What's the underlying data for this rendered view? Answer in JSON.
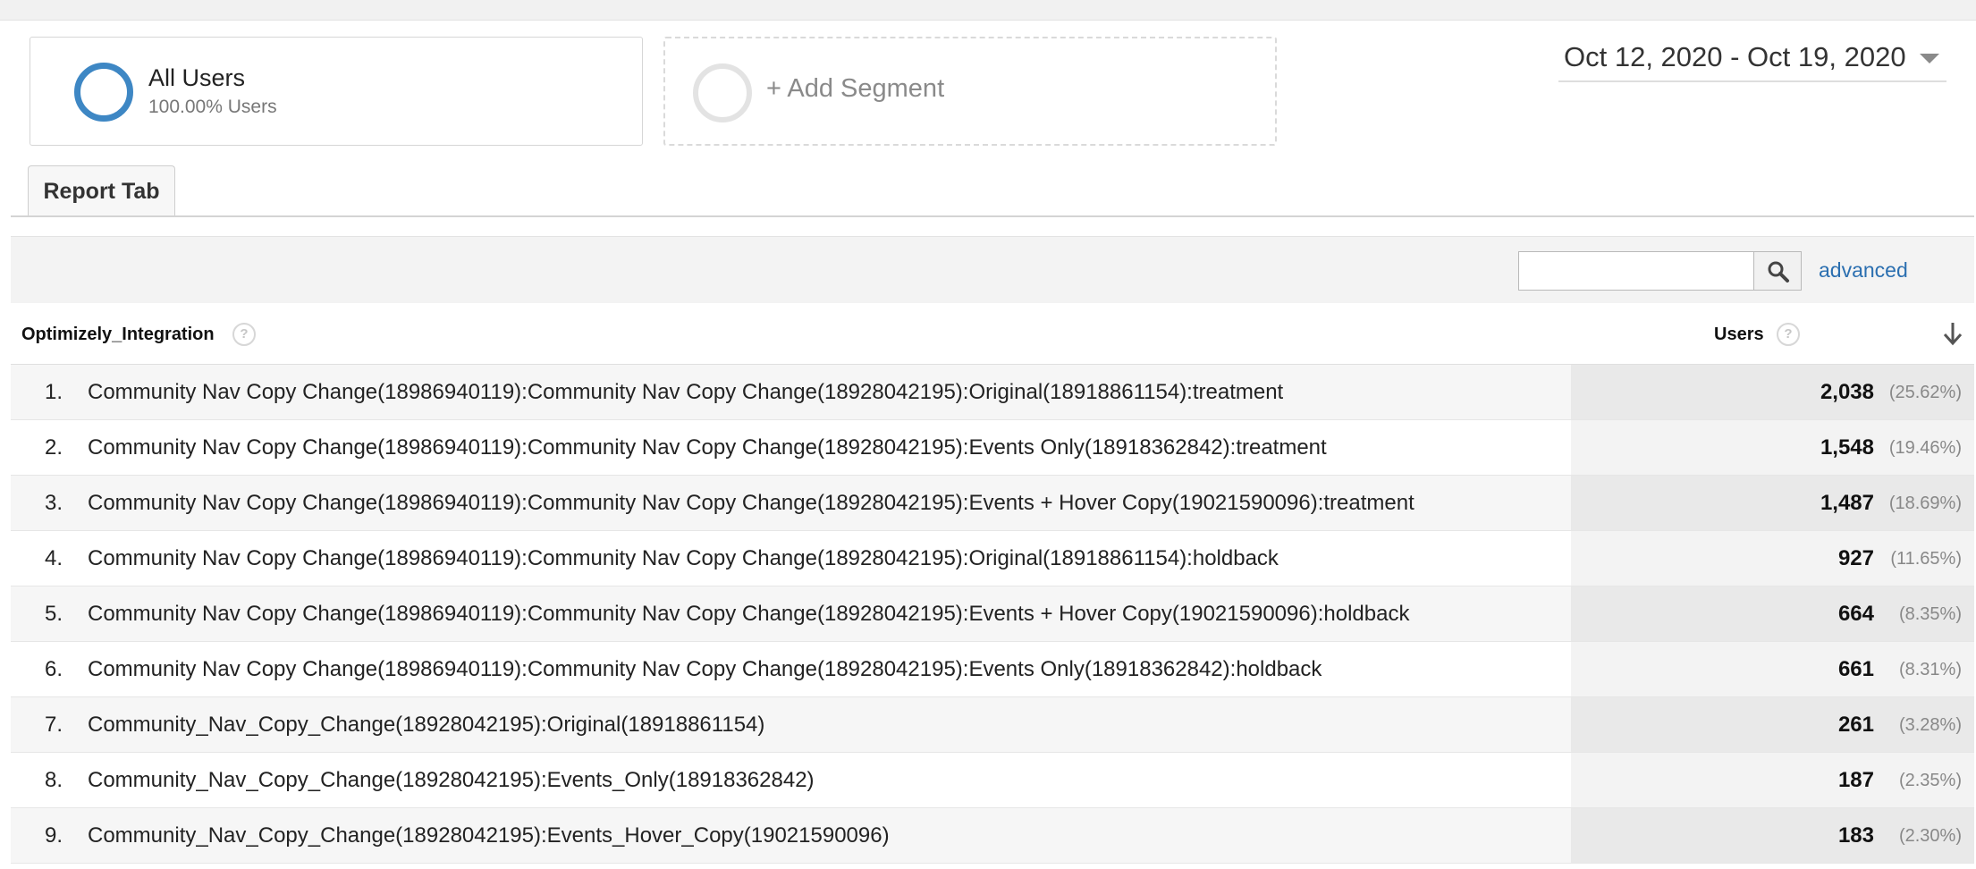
{
  "segments": {
    "all_users": {
      "name": "All Users",
      "sub": "100.00% Users"
    },
    "add_segment_label": "+ Add Segment"
  },
  "date_range": "Oct 12, 2020 - Oct 19, 2020",
  "report_tab_label": "Report Tab",
  "search": {
    "value": "",
    "placeholder": ""
  },
  "advanced_label": "advanced",
  "table": {
    "dimension_header": "Optimizely_Integration",
    "metric_header": "Users",
    "rows": [
      {
        "num": "1.",
        "label": "Community Nav Copy Change(18986940119):Community Nav Copy Change(18928042195):Original(18918861154):treatment",
        "value": "2,038",
        "pct": "(25.62%)"
      },
      {
        "num": "2.",
        "label": "Community Nav Copy Change(18986940119):Community Nav Copy Change(18928042195):Events Only(18918362842):treatment",
        "value": "1,548",
        "pct": "(19.46%)"
      },
      {
        "num": "3.",
        "label": "Community Nav Copy Change(18986940119):Community Nav Copy Change(18928042195):Events + Hover Copy(19021590096):treatment",
        "value": "1,487",
        "pct": "(18.69%)"
      },
      {
        "num": "4.",
        "label": "Community Nav Copy Change(18986940119):Community Nav Copy Change(18928042195):Original(18918861154):holdback",
        "value": "927",
        "pct": "(11.65%)"
      },
      {
        "num": "5.",
        "label": "Community Nav Copy Change(18986940119):Community Nav Copy Change(18928042195):Events + Hover Copy(19021590096):holdback",
        "value": "664",
        "pct": "(8.35%)"
      },
      {
        "num": "6.",
        "label": "Community Nav Copy Change(18986940119):Community Nav Copy Change(18928042195):Events Only(18918362842):holdback",
        "value": "661",
        "pct": "(8.31%)"
      },
      {
        "num": "7.",
        "label": "Community_Nav_Copy_Change(18928042195):Original(18918861154)",
        "value": "261",
        "pct": "(3.28%)"
      },
      {
        "num": "8.",
        "label": "Community_Nav_Copy_Change(18928042195):Events_Only(18918362842)",
        "value": "187",
        "pct": "(2.35%)"
      },
      {
        "num": "9.",
        "label": "Community_Nav_Copy_Change(18928042195):Events_Hover_Copy(19021590096)",
        "value": "183",
        "pct": "(2.30%)"
      }
    ]
  },
  "colors": {
    "accent": "#3e87c4",
    "link": "#2b6fb0"
  },
  "icons": [
    "search-icon",
    "help-icon",
    "sort-down-arrow-icon",
    "dropdown-caret-icon",
    "segment-ring-icon"
  ]
}
